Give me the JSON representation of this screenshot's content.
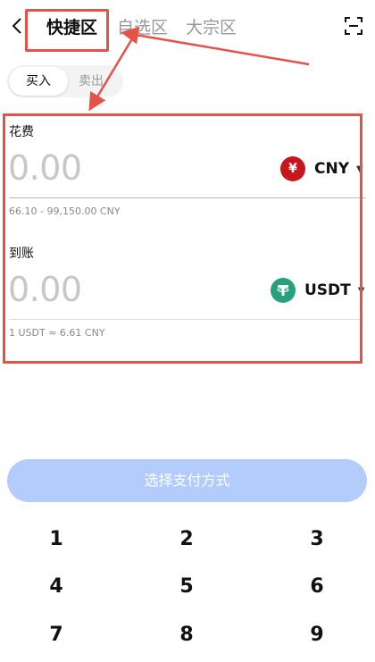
{
  "header": {
    "tabs": [
      {
        "label": "快捷区"
      },
      {
        "label": "自选区"
      },
      {
        "label": "大宗区"
      }
    ]
  },
  "mode": {
    "buy_label": "买入",
    "sell_label": "卖出"
  },
  "spend": {
    "label": "花费",
    "amount": "0.00",
    "currency": "CNY",
    "currency_symbol": "¥",
    "range": "66.10 - 99,150.00 CNY"
  },
  "receive": {
    "label": "到账",
    "amount": "0.00",
    "currency": "USDT",
    "rate": "1 USDT ≈ 6.61 CNY"
  },
  "pay_button": {
    "label": "选择支付方式"
  },
  "keypad": {
    "keys": [
      "1",
      "2",
      "3",
      "4",
      "5",
      "6",
      "7",
      "8",
      "9"
    ]
  },
  "colors": {
    "accent_red": "#e5524a",
    "button_blue": "#b3ccfb",
    "cny_red": "#c8161e",
    "usdt_green": "#26a17b"
  },
  "icons": {
    "back": "chevron-left-icon",
    "scan": "scan-icon"
  }
}
